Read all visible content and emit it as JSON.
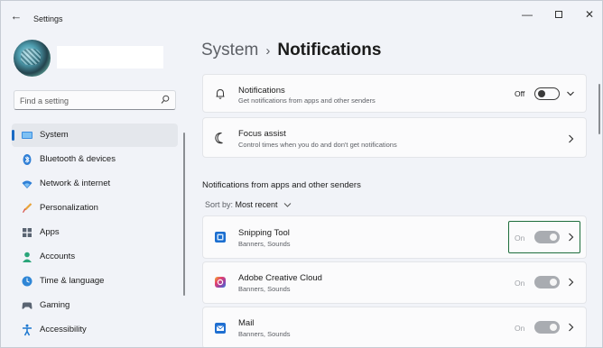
{
  "window": {
    "title": "Settings",
    "back_icon": "arrow-left-icon",
    "controls": {
      "minimize": "—",
      "close": "✕"
    }
  },
  "search": {
    "placeholder": "Find a setting",
    "icon": "search-icon"
  },
  "sidebar": {
    "items": [
      {
        "label": "System",
        "icon": "monitor-icon",
        "active": true
      },
      {
        "label": "Bluetooth & devices",
        "icon": "bluetooth-icon"
      },
      {
        "label": "Network & internet",
        "icon": "wifi-icon"
      },
      {
        "label": "Personalization",
        "icon": "brush-icon"
      },
      {
        "label": "Apps",
        "icon": "apps-grid-icon"
      },
      {
        "label": "Accounts",
        "icon": "person-icon"
      },
      {
        "label": "Time & language",
        "icon": "globe-clock-icon"
      },
      {
        "label": "Gaming",
        "icon": "gamepad-icon"
      },
      {
        "label": "Accessibility",
        "icon": "accessibility-icon"
      }
    ]
  },
  "breadcrumb": {
    "parent": "System",
    "separator": "›",
    "current": "Notifications"
  },
  "notifications_card": {
    "title": "Notifications",
    "subtitle": "Get notifications from apps and other senders",
    "toggle_label": "Off",
    "toggle_on": false
  },
  "focus_card": {
    "title": "Focus assist",
    "subtitle": "Control times when you do and don't get notifications"
  },
  "apps_section": {
    "title": "Notifications from apps and other senders",
    "sort_label": "Sort by:",
    "sort_value": "Most recent",
    "apps": [
      {
        "name": "Snipping Tool",
        "detail": "Banners, Sounds",
        "toggle_label": "On",
        "icon": "snipping-tool-icon"
      },
      {
        "name": "Adobe Creative Cloud",
        "detail": "Banners, Sounds",
        "toggle_label": "On",
        "icon": "adobe-cc-icon"
      },
      {
        "name": "Mail",
        "detail": "Banners, Sounds",
        "toggle_label": "On",
        "icon": "mail-icon"
      }
    ]
  },
  "colors": {
    "accent": "#1a6ac4",
    "highlight": "#1e6e3c",
    "toggle_disabled": "#a9acb1"
  }
}
